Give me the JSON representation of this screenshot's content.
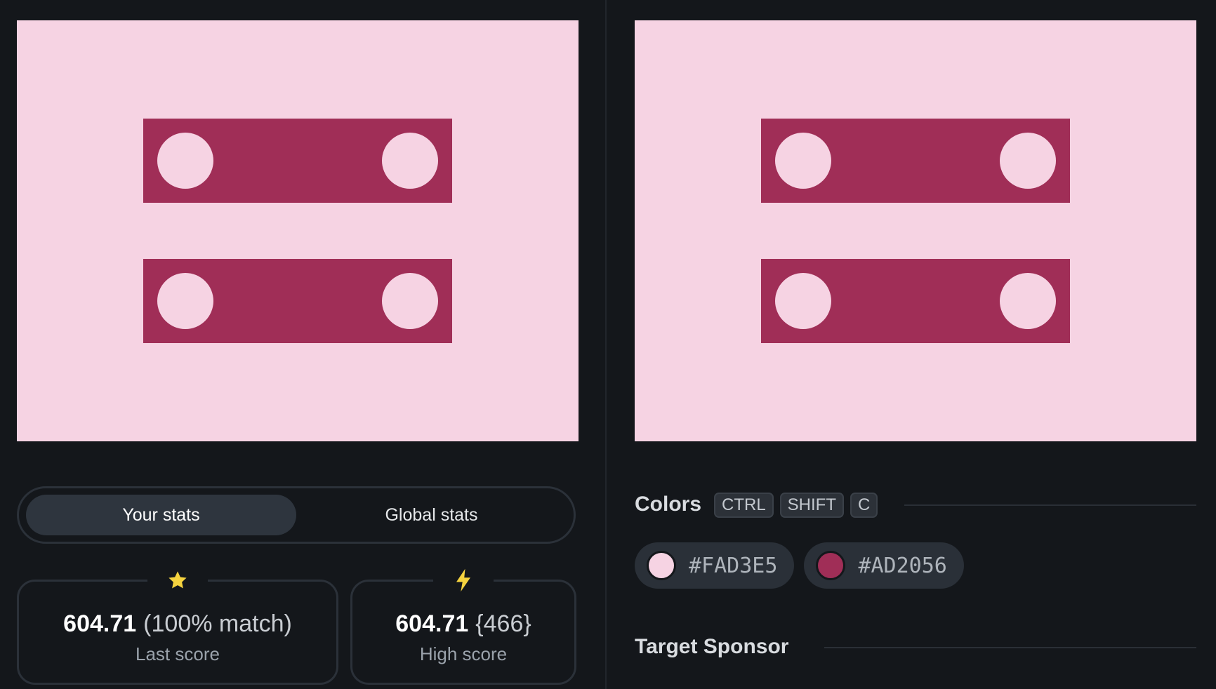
{
  "colors": {
    "background": "#F6D3E3",
    "shape": "#A02E57",
    "page_bg": "#14171B",
    "accent_star": "#F5D33F"
  },
  "stats": {
    "tabs": [
      {
        "label": "Your stats",
        "active": true
      },
      {
        "label": "Global stats",
        "active": false
      }
    ],
    "last": {
      "icon": "star-icon",
      "value": "604.71",
      "extra": "(100% match)",
      "label": "Last score"
    },
    "high": {
      "icon": "bolt-icon",
      "value": "604.71",
      "extra": "{466}",
      "label": "High score"
    }
  },
  "palette": {
    "title": "Colors",
    "shortcut": [
      "CTRL",
      "SHIFT",
      "C"
    ],
    "swatches": [
      {
        "hex": "#FAD3E5",
        "color": "#FAD3E5"
      },
      {
        "hex": "#AD2056",
        "color": "#A02E57"
      }
    ]
  },
  "sponsor": {
    "title": "Target Sponsor"
  }
}
